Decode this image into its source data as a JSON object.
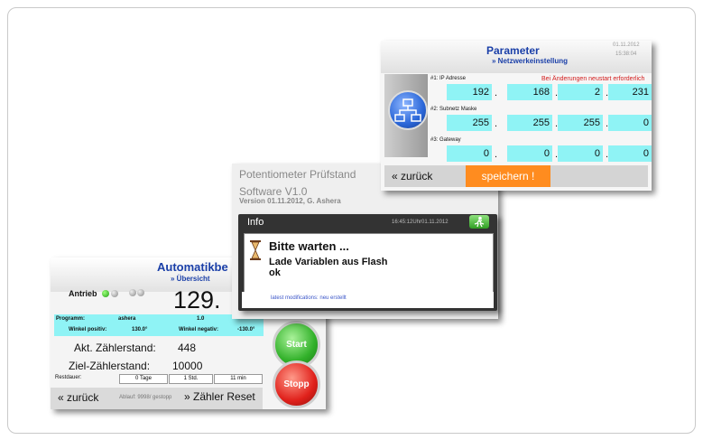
{
  "automatik": {
    "title": "Automatikbe",
    "subtitle": "» Übersicht",
    "antrieb_label": "Antrieb",
    "big_value": "129.",
    "programm_label": "Programm:",
    "programm_value": "ashera",
    "programm_num": "1.0",
    "winkel_pos_label": "Winkel positiv:",
    "winkel_pos_value": "130.0°",
    "winkel_neg_label": "Winkel negativ:",
    "winkel_neg_value": "-130.0°",
    "akt_label": "Akt. Zählerstand:",
    "akt_value": "448",
    "ziel_label": "Ziel-Zählerstand:",
    "ziel_value": "10000",
    "restdauer_label": "Restdauer:",
    "restdauer_tage": "0 Tage",
    "restdauer_std": "1 Std.",
    "restdauer_min": "11 min",
    "back_label": "« zurück",
    "ablauf_text": "Ablauf: 9998/ gestopp",
    "reset_label": "» Zähler Reset",
    "start_label": "Start",
    "stop_label": "Stopp"
  },
  "poti": {
    "title": "Potentiometer Prüfstand",
    "software": "Software V1.0",
    "version": "Version 01.11.2012, G. Ashera"
  },
  "info": {
    "title": "Info",
    "timestamp": "16:45:12Uhr01.11.2012",
    "msg1": "Bitte warten ...",
    "msg2": "Lade Variablen aus Flash",
    "msg3": "ok",
    "footer": "latest modifications: neu erstellt"
  },
  "param": {
    "title": "Parameter",
    "subtitle": "» Netzwerkeinstellung",
    "date": "01.11.2012",
    "time": "15:38:04",
    "note": "Bei Änderungen neustart erforderlich",
    "rows": [
      {
        "label": "#1: IP Adresse",
        "values": [
          "192",
          "168",
          "2",
          "231"
        ]
      },
      {
        "label": "#2: Subnetz Maske",
        "values": [
          "255",
          "255",
          "255",
          "0"
        ]
      },
      {
        "label": "#3: Gateway",
        "values": [
          "0",
          "0",
          "0",
          "0"
        ]
      }
    ],
    "back_label": "« zurück",
    "save_label": "speichern !"
  },
  "colors": {
    "title_blue": "#1a3fa8",
    "cyan_field": "#8ff3f5",
    "save_orange": "#ff8c1f",
    "warning_red": "#d21b1b"
  },
  "icons": [
    "led-green",
    "led-grey",
    "hourglass-icon",
    "exit-icon",
    "network-icon"
  ]
}
